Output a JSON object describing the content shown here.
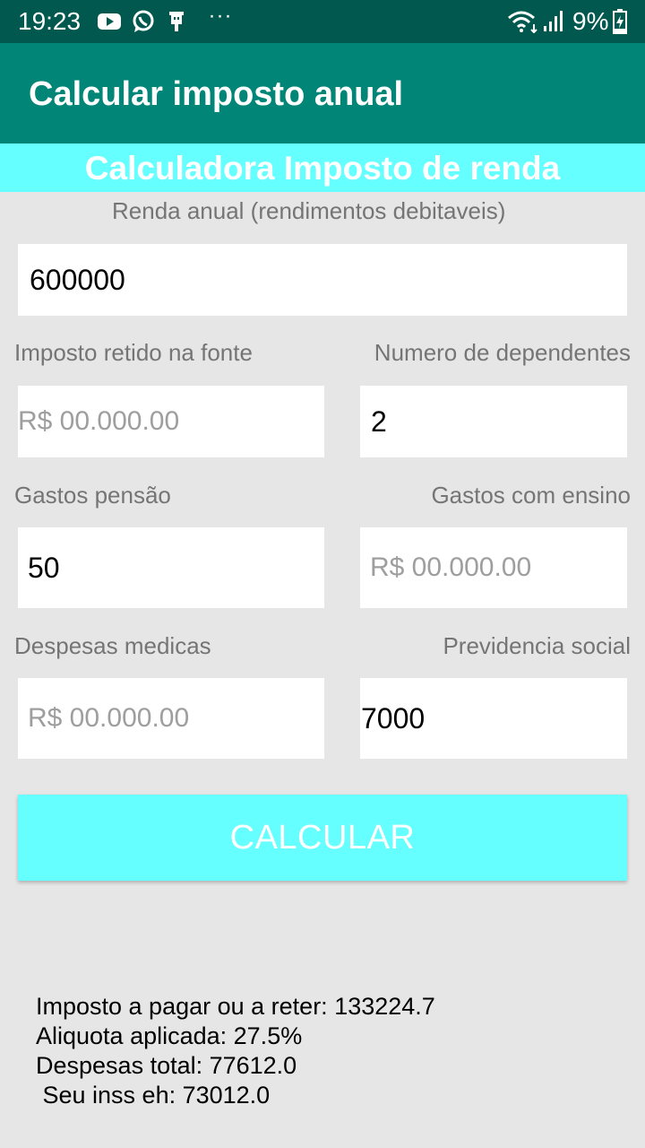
{
  "status_bar": {
    "time": "19:23",
    "battery_percent": "9%",
    "icons": [
      "youtube-icon",
      "whatsapp-icon",
      "usb-icon",
      "more-dots-icon",
      "wifi-icon",
      "signal-icon",
      "battery-charging-icon"
    ],
    "more_glyph": "···"
  },
  "toolbar": {
    "title": "Calcular imposto anual"
  },
  "banner": {
    "title": "Calculadora Imposto de renda"
  },
  "form": {
    "renda_anual": {
      "label": "Renda anual (rendimentos debitaveis)",
      "value": "600000"
    },
    "imposto_retido": {
      "label": "Imposto retido na fonte",
      "placeholder": "R$ 00.000.00"
    },
    "numero_dependentes": {
      "label": "Numero de dependentes",
      "value": "2"
    },
    "gastos_pensao": {
      "label": "Gastos pensão",
      "value": "50"
    },
    "gastos_ensino": {
      "label": "Gastos com ensino",
      "placeholder": "R$ 00.000.00"
    },
    "despesas_medicas": {
      "label": "Despesas medicas",
      "placeholder": "R$ 00.000.00"
    },
    "previdencia_social": {
      "label": "Previdencia social",
      "value": "7000"
    }
  },
  "calculate_button": {
    "label": "CALCULAR"
  },
  "results": {
    "line1": "Imposto a pagar ou a reter: 133224.7",
    "line2": "Aliquota aplicada: 27.5%",
    "line3": "Despesas total: 77612.0",
    "line4": " Seu inss eh: 73012.0"
  },
  "colors": {
    "status_bar": "#00584e",
    "toolbar": "#008577",
    "accent_cyan": "#66ffff",
    "background": "#e6e6e6"
  }
}
